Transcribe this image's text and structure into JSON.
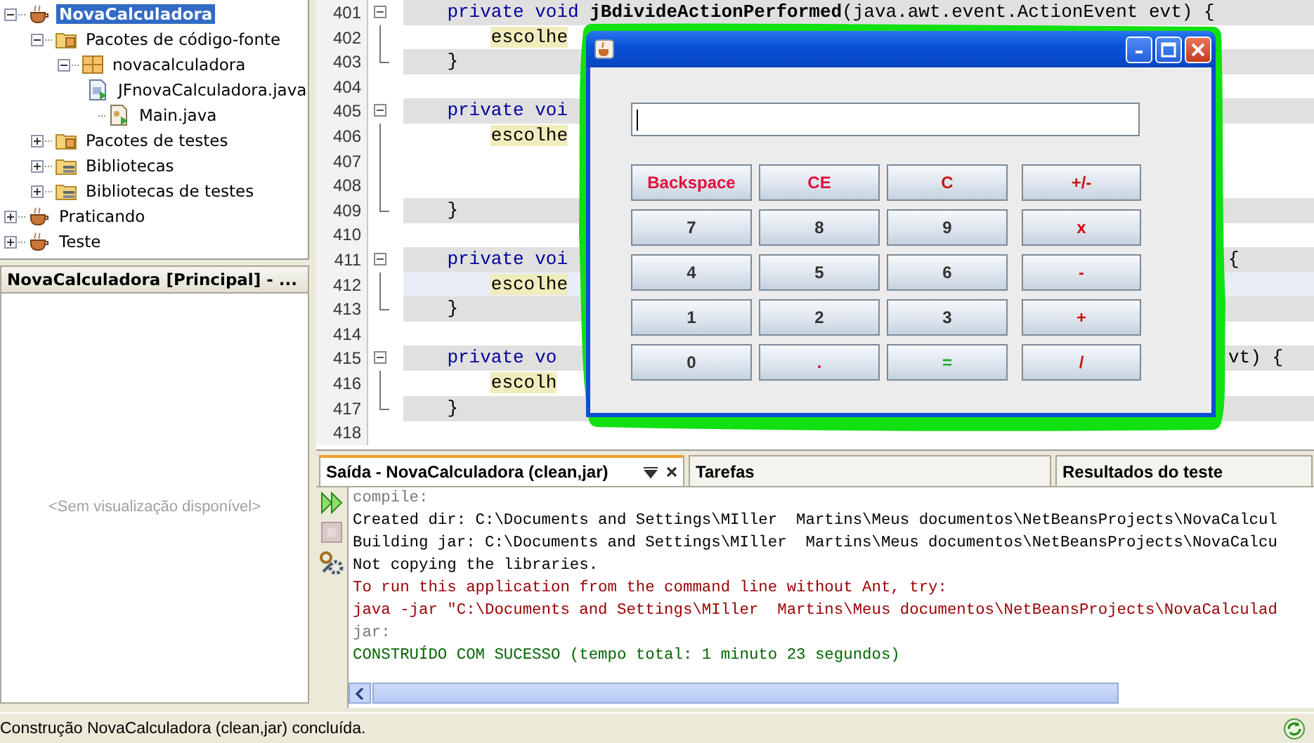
{
  "project_tree": [
    {
      "label": "NovaCalculadora",
      "kind": "project",
      "expanded": true,
      "selected": true,
      "children": [
        {
          "label": "Pacotes de código-fonte",
          "kind": "source-folder",
          "expanded": true,
          "selected": false,
          "children": [
            {
              "label": "novacalculadora",
              "kind": "package",
              "expanded": true,
              "selected": false,
              "children": [
                {
                  "label": "JFnovaCalculadora.java",
                  "kind": "form-file",
                  "selected": false
                },
                {
                  "label": "Main.java",
                  "kind": "java-file",
                  "selected": false
                }
              ]
            }
          ]
        },
        {
          "label": "Pacotes de testes",
          "kind": "source-folder",
          "expanded": false,
          "selected": false
        },
        {
          "label": "Bibliotecas",
          "kind": "library",
          "expanded": false,
          "selected": false
        },
        {
          "label": "Bibliotecas de testes",
          "kind": "library",
          "expanded": false,
          "selected": false
        }
      ]
    },
    {
      "label": "Praticando",
      "kind": "project",
      "expanded": false,
      "selected": false
    },
    {
      "label": "Teste",
      "kind": "project",
      "expanded": false,
      "selected": false
    }
  ],
  "navigator": {
    "title": "NovaCalculadora [Principal] - ...",
    "empty_message": "<Sem visualização disponível>"
  },
  "editor": {
    "lines": [
      {
        "number": "401",
        "kind": "signature",
        "fold_head": true,
        "fold_body": false,
        "fold_end": false,
        "highlighted": true,
        "current": false,
        "segments": [
          {
            "kind": "keyword",
            "text": "private void "
          },
          {
            "kind": "method",
            "text": "jBdivideActionPerformed"
          },
          {
            "kind": "plain",
            "text": "(java.awt.event.ActionEvent evt) {"
          }
        ]
      },
      {
        "number": "402",
        "kind": "statement",
        "fold_head": false,
        "fold_body": true,
        "fold_end": false,
        "highlighted": false,
        "current": false,
        "segments": [
          {
            "kind": "marked",
            "text": "escolhe"
          }
        ]
      },
      {
        "number": "403",
        "kind": "close",
        "fold_head": false,
        "fold_body": false,
        "fold_end": true,
        "highlighted": true,
        "current": false,
        "segments": [
          {
            "kind": "plain",
            "text": "}"
          }
        ]
      },
      {
        "number": "404",
        "kind": "blank",
        "fold_head": false,
        "fold_body": false,
        "fold_end": false,
        "highlighted": false,
        "current": false
      },
      {
        "number": "405",
        "kind": "signature",
        "fold_head": true,
        "fold_body": false,
        "fold_end": false,
        "highlighted": true,
        "current": false,
        "segments": [
          {
            "kind": "keyword",
            "text": "private voi"
          }
        ]
      },
      {
        "number": "406",
        "kind": "statement",
        "fold_head": false,
        "fold_body": true,
        "fold_end": false,
        "highlighted": false,
        "current": false,
        "segments": [
          {
            "kind": "marked",
            "text": "escolhe"
          }
        ]
      },
      {
        "number": "407",
        "kind": "blank",
        "fold_head": false,
        "fold_body": true,
        "fold_end": false,
        "highlighted": false,
        "current": false
      },
      {
        "number": "408",
        "kind": "blank",
        "fold_head": false,
        "fold_body": true,
        "fold_end": false,
        "highlighted": false,
        "current": false
      },
      {
        "number": "409",
        "kind": "close",
        "fold_head": false,
        "fold_body": false,
        "fold_end": true,
        "highlighted": true,
        "current": false,
        "segments": [
          {
            "kind": "plain",
            "text": "}"
          }
        ]
      },
      {
        "number": "410",
        "kind": "blank",
        "fold_head": false,
        "fold_body": false,
        "fold_end": false,
        "highlighted": false,
        "current": false
      },
      {
        "number": "411",
        "kind": "signature",
        "fold_head": true,
        "fold_body": false,
        "fold_end": false,
        "highlighted": true,
        "current": false,
        "segments": [
          {
            "kind": "keyword",
            "text": "private voi"
          }
        ],
        "tail": "{"
      },
      {
        "number": "412",
        "kind": "statement",
        "fold_head": false,
        "fold_body": true,
        "fold_end": false,
        "highlighted": false,
        "current": true,
        "segments": [
          {
            "kind": "marked",
            "text": "escolhe"
          }
        ]
      },
      {
        "number": "413",
        "kind": "close",
        "fold_head": false,
        "fold_body": false,
        "fold_end": true,
        "highlighted": true,
        "current": false,
        "segments": [
          {
            "kind": "plain",
            "text": "}"
          }
        ]
      },
      {
        "number": "414",
        "kind": "blank",
        "fold_head": false,
        "fold_body": false,
        "fold_end": false,
        "highlighted": false,
        "current": false
      },
      {
        "number": "415",
        "kind": "signature",
        "fold_head": true,
        "fold_body": false,
        "fold_end": false,
        "highlighted": true,
        "current": false,
        "segments": [
          {
            "kind": "keyword",
            "text": "private vo"
          }
        ],
        "tail": "vt) {"
      },
      {
        "number": "416",
        "kind": "statement",
        "fold_head": false,
        "fold_body": true,
        "fold_end": false,
        "highlighted": false,
        "current": false,
        "segments": [
          {
            "kind": "marked",
            "text": "escolh"
          }
        ]
      },
      {
        "number": "417",
        "kind": "close",
        "fold_head": false,
        "fold_body": false,
        "fold_end": true,
        "highlighted": true,
        "current": false,
        "segments": [
          {
            "kind": "plain",
            "text": "}"
          }
        ]
      },
      {
        "number": "418",
        "kind": "blank",
        "fold_head": false,
        "fold_body": false,
        "fold_end": false,
        "highlighted": false,
        "current": false
      }
    ]
  },
  "calculator": {
    "buttons": [
      {
        "label": "Backspace",
        "color": "#e0103c"
      },
      {
        "label": "CE",
        "color": "#e0103c"
      },
      {
        "label": "C",
        "color": "#cc1111"
      },
      {
        "label": "+/-",
        "color": "#cc1111"
      },
      {
        "label": "7",
        "color": "#333333"
      },
      {
        "label": "8",
        "color": "#333333"
      },
      {
        "label": "9",
        "color": "#333333"
      },
      {
        "label": "x",
        "color": "#dd0000"
      },
      {
        "label": "4",
        "color": "#333333"
      },
      {
        "label": "5",
        "color": "#333333"
      },
      {
        "label": "6",
        "color": "#333333"
      },
      {
        "label": "-",
        "color": "#cc1111"
      },
      {
        "label": "1",
        "color": "#333333"
      },
      {
        "label": "2",
        "color": "#333333"
      },
      {
        "label": "3",
        "color": "#333333"
      },
      {
        "label": "+",
        "color": "#cc1111"
      },
      {
        "label": "0",
        "color": "#333333"
      },
      {
        "label": ".",
        "color": "#cc1144"
      },
      {
        "label": "=",
        "color": "#22aa22"
      },
      {
        "label": "/",
        "color": "#cc1111"
      }
    ]
  },
  "output": {
    "tabs": [
      {
        "label": "Saída - NovaCalculadora (clean,jar)",
        "selected": true
      },
      {
        "label": "Tarefas",
        "selected": false
      },
      {
        "label": "Resultados do teste",
        "selected": false
      }
    ],
    "lines": [
      {
        "kind": "faded",
        "text": "compile:"
      },
      {
        "kind": "normal",
        "text": "Created dir: C:\\Documents and Settings\\MIller  Martins\\Meus documentos\\NetBeansProjects\\NovaCalcul"
      },
      {
        "kind": "normal",
        "text": "Building jar: C:\\Documents and Settings\\MIller  Martins\\Meus documentos\\NetBeansProjects\\NovaCalcu"
      },
      {
        "kind": "normal",
        "text": "Not copying the libraries."
      },
      {
        "kind": "error",
        "text": "To run this application from the command line without Ant, try:"
      },
      {
        "kind": "error",
        "text": "java -jar \"C:\\Documents and Settings\\MIller  Martins\\Meus documentos\\NetBeansProjects\\NovaCalculad"
      },
      {
        "kind": "faded",
        "text": "jar:"
      },
      {
        "kind": "success",
        "text": "CONSTRUÍDO COM SUCESSO (tempo total: 1 minuto 23 segundos)"
      }
    ]
  },
  "status_bar": {
    "text": "Construção NovaCalculadora (clean,jar) concluída."
  }
}
